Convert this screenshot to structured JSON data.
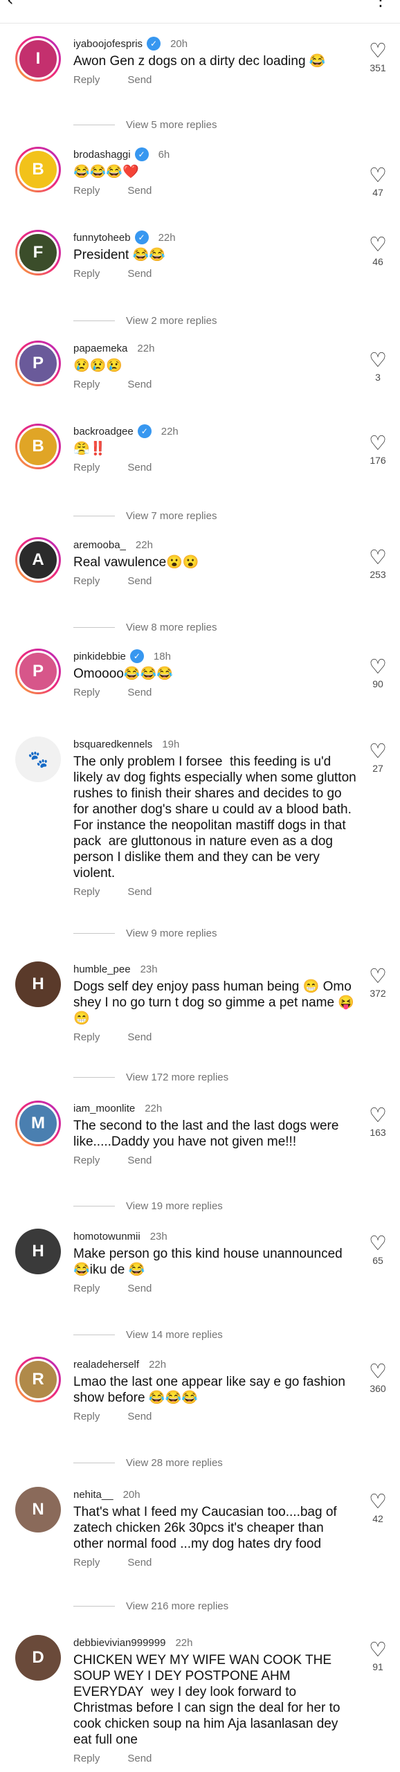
{
  "header": {
    "back_icon": "‹",
    "more_icon": "⋮"
  },
  "actions": {
    "reply": "Reply",
    "send": "Send"
  },
  "comments": [
    {
      "user": "iyaboojofespris",
      "verified": true,
      "time": "20h",
      "text": "Awon Gen z dogs on a dirty dec loading 😂",
      "likes": "351",
      "avatar_color": "#c4306e",
      "avatar_glyph": "I",
      "story": true,
      "replies": "View 5 more replies"
    },
    {
      "user": "brodashaggi",
      "verified": true,
      "time": "6h",
      "text": "😂😂😂❤️",
      "likes": "47",
      "avatar_color": "#f2c21a",
      "avatar_glyph": "B",
      "story": true,
      "replies": ""
    },
    {
      "user": "funnytoheeb",
      "verified": true,
      "time": "22h",
      "text": "President 😂😂",
      "likes": "46",
      "avatar_color": "#3b4d2a",
      "avatar_glyph": "F",
      "story": true,
      "replies": "View 2 more replies"
    },
    {
      "user": "papaemeka",
      "verified": false,
      "time": "22h",
      "text": "😢😢😢",
      "likes": "3",
      "avatar_color": "#6a5a9a",
      "avatar_glyph": "P",
      "story": true,
      "replies": ""
    },
    {
      "user": "backroadgee",
      "verified": true,
      "time": "22h",
      "text": "😤‼️",
      "likes": "176",
      "avatar_color": "#e0a526",
      "avatar_glyph": "B",
      "story": true,
      "replies": "View 7 more replies"
    },
    {
      "user": "aremooba_",
      "verified": false,
      "time": "22h",
      "text": "Real vawulence😮😮",
      "likes": "253",
      "avatar_color": "#2b2b2b",
      "avatar_glyph": "A",
      "story": true,
      "replies": "View 8 more replies"
    },
    {
      "user": "pinkidebbie",
      "verified": true,
      "time": "18h",
      "text": "Omoooo😂😂😂",
      "likes": "90",
      "avatar_color": "#d7568a",
      "avatar_glyph": "P",
      "story": true,
      "replies": ""
    },
    {
      "user": "bsquaredkennels",
      "verified": false,
      "time": "19h",
      "text": "The only problem I forsee  this feeding is u'd likely av dog fights especially when some glutton rushes to finish their shares and decides to go for another dog's share u could av a blood bath. For instance the neopolitan mastiff dogs in that pack  are gluttonous in nature even as a dog person I dislike them and they can be very violent.",
      "likes": "27",
      "avatar_color": "#f1f1f1",
      "avatar_glyph": "🐾",
      "story": false,
      "replies": "View 9 more replies"
    },
    {
      "user": "humble_pee",
      "verified": false,
      "time": "23h",
      "text": "Dogs self dey enjoy pass human being 😁 Omo shey I no go turn t dog so gimme a pet name 😝😁",
      "likes": "372",
      "avatar_color": "#5a3a2a",
      "avatar_glyph": "H",
      "story": false,
      "replies": "View 172 more replies"
    },
    {
      "user": "iam_moonlite",
      "verified": false,
      "time": "22h",
      "text": "The second to the last and the last dogs were like.....Daddy you have not given me!!!",
      "likes": "163",
      "avatar_color": "#4a7fb0",
      "avatar_glyph": "M",
      "story": true,
      "replies": "View 19 more replies"
    },
    {
      "user": "homotowunmii",
      "verified": false,
      "time": "23h",
      "text": "Make person go this kind house unannounced 😂iku de 😂",
      "likes": "65",
      "avatar_color": "#3a3a3a",
      "avatar_glyph": "H",
      "story": false,
      "replies": "View 14 more replies"
    },
    {
      "user": "realadeherself",
      "verified": false,
      "time": "22h",
      "text": "Lmao the last one appear like say e go fashion show before 😂😂😂",
      "likes": "360",
      "avatar_color": "#b08a4a",
      "avatar_glyph": "R",
      "story": true,
      "replies": "View 28 more replies"
    },
    {
      "user": "nehita__",
      "verified": false,
      "time": "20h",
      "text": "That's what I feed my Caucasian too....bag of zatech chicken 26k 30pcs it's cheaper than other normal food ...my dog hates dry food",
      "likes": "42",
      "avatar_color": "#8a6a5a",
      "avatar_glyph": "N",
      "story": false,
      "replies": "View 216 more replies"
    },
    {
      "user": "debbievivian999999",
      "verified": false,
      "time": "22h",
      "text": "CHICKEN WEY MY WIFE WAN COOK THE SOUP WEY I DEY POSTPONE AHM EVERYDAY  wey I dey look forward to Christmas before I can sign the deal for her to cook chicken soup na him Aja lasanlasan dey eat full one",
      "likes": "91",
      "avatar_color": "#6a4a3a",
      "avatar_glyph": "D",
      "story": false,
      "replies": ""
    }
  ]
}
